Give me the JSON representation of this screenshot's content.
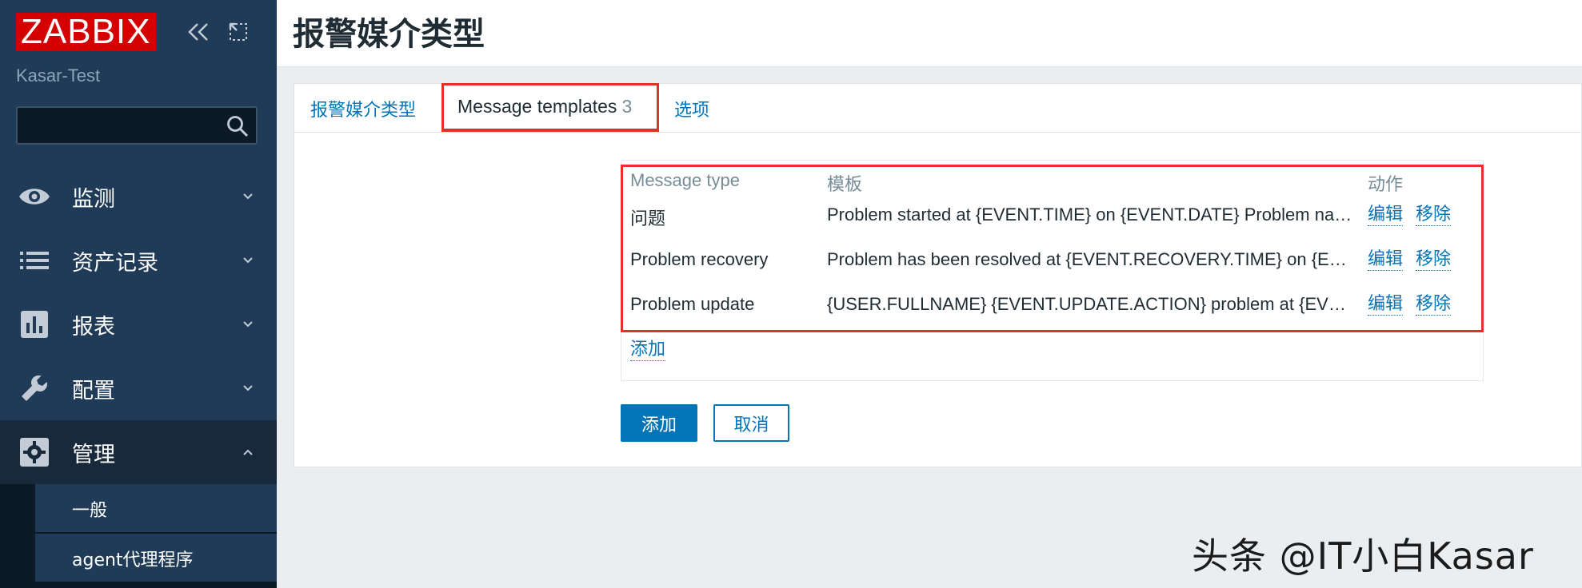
{
  "sidebar": {
    "logo_text": "ZABBIX",
    "server_name": "Kasar-Test",
    "search_placeholder": "",
    "menu": [
      {
        "label": "监测",
        "icon": "eye-icon"
      },
      {
        "label": "资产记录",
        "icon": "list-icon"
      },
      {
        "label": "报表",
        "icon": "bar-chart-icon"
      },
      {
        "label": "配置",
        "icon": "wrench-icon"
      },
      {
        "label": "管理",
        "icon": "gear-icon",
        "expanded": true
      }
    ],
    "submenu": [
      {
        "label": "一般"
      },
      {
        "label": "agent代理程序"
      }
    ]
  },
  "page": {
    "title": "报警媒介类型"
  },
  "tabs": {
    "type_label": "报警媒介类型",
    "templates_label": "Message templates",
    "templates_count": "3",
    "options_label": "选项"
  },
  "table": {
    "headers": {
      "type": "Message type",
      "template": "模板",
      "action": "动作"
    },
    "rows": [
      {
        "type": "问题",
        "template": "Problem started at {EVENT.TIME} on {EVENT.DATE} Problem name: {EVENT.NAME}",
        "edit": "编辑",
        "remove": "移除"
      },
      {
        "type": "Problem recovery",
        "template": "Problem has been resolved at {EVENT.RECOVERY.TIME} on {EVENT.RECOVERY.DATE}",
        "edit": "编辑",
        "remove": "移除"
      },
      {
        "type": "Problem update",
        "template": "{USER.FULLNAME} {EVENT.UPDATE.ACTION} problem at {EVENT.UPDATE.DATE}",
        "edit": "编辑",
        "remove": "移除"
      }
    ],
    "add_link": "添加"
  },
  "buttons": {
    "add": "添加",
    "cancel": "取消"
  },
  "watermark": "头条 @IT小白Kasar",
  "colors": {
    "sidebar_bg": "#1f3b57",
    "accent": "#0275b8",
    "highlight_red": "#e3312a",
    "logo_red": "#d40000"
  }
}
